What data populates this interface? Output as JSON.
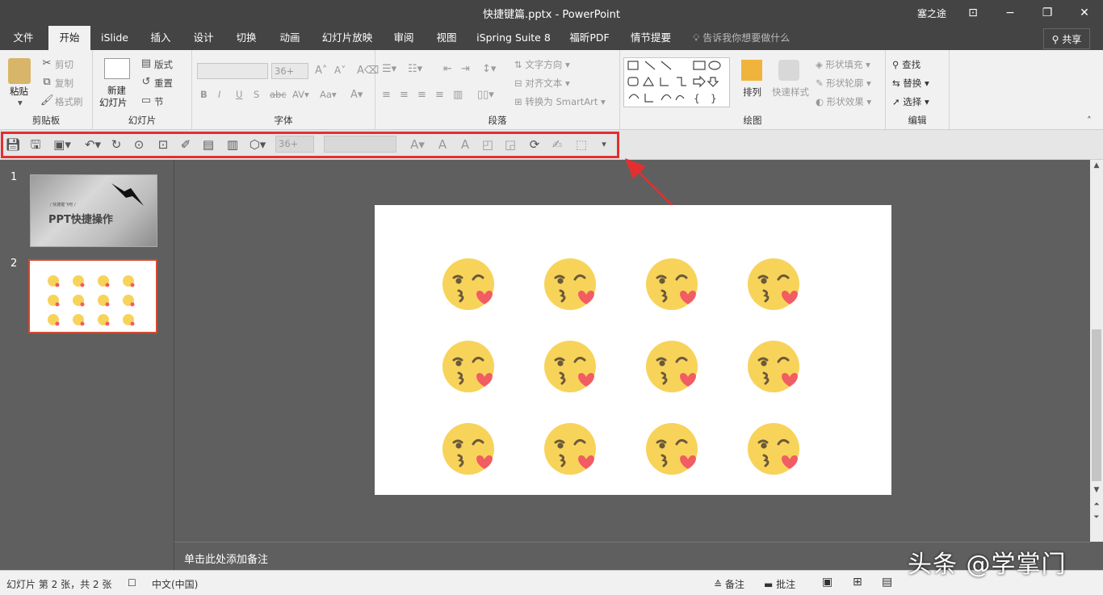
{
  "window": {
    "title": "快捷键篇.pptx  -  PowerPoint",
    "user": "塞之途",
    "minimize": "−",
    "restore": "❐",
    "close": "✕",
    "ribbon_display": "⊡"
  },
  "tabs": [
    "文件",
    "开始",
    "iSlide",
    "插入",
    "设计",
    "切换",
    "动画",
    "幻灯片放映",
    "审阅",
    "视图",
    "iSpring Suite 8",
    "福昕PDF",
    "情节提要"
  ],
  "active_tab": "开始",
  "tell_me": "告诉我你想要做什么",
  "share": "共享",
  "ribbon": {
    "clipboard": {
      "label": "剪贴板",
      "paste": "粘贴",
      "cut": "剪切",
      "copy": "复制",
      "format_painter": "格式刷"
    },
    "slides": {
      "label": "幻灯片",
      "new_slide_1": "新建",
      "new_slide_2": "幻灯片",
      "layout": "版式",
      "reset": "重置",
      "section": "节"
    },
    "font": {
      "label": "字体",
      "size": "36+"
    },
    "paragraph": {
      "label": "段落",
      "text_direction": "文字方向",
      "align_text": "对齐文本",
      "smartart": "转换为 SmartArt"
    },
    "drawing": {
      "label": "绘图",
      "arrange": "排列",
      "quick_styles": "快速样式",
      "shape_fill": "形状填充",
      "shape_outline": "形状轮廓",
      "shape_effects": "形状效果"
    },
    "editing": {
      "label": "编辑",
      "find": "查找",
      "replace": "替换",
      "select": "选择"
    }
  },
  "qat": {
    "font_size": "36+"
  },
  "slides": [
    {
      "number": "1",
      "subtitle": "/ 快捷键飞吧 /",
      "title": "PPT快捷操作"
    },
    {
      "number": "2"
    }
  ],
  "current_slide_emoji_count": 12,
  "notes_placeholder": "单击此处添加备注",
  "status": {
    "slide_info": "幻灯片 第 2 张，共 2 张",
    "language": "中文(中国)",
    "notes": "备注",
    "comments": "批注"
  },
  "watermark": "头条 @学掌门",
  "colors": {
    "accent": "#e23030",
    "titlebar": "#444444",
    "emoji_face": "#f8d35a",
    "heart": "#f25c63"
  }
}
